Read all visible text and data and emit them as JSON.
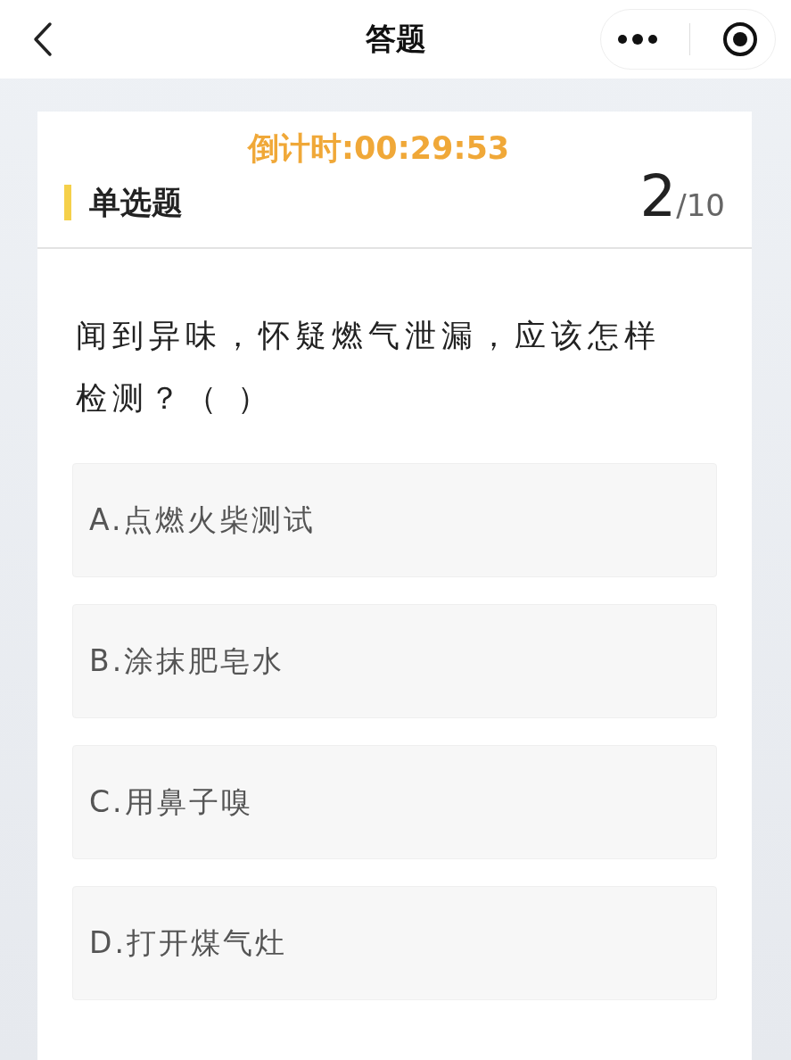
{
  "nav": {
    "title": "答题"
  },
  "header": {
    "countdown": "倒计时:00:29:53",
    "type_label": "单选题",
    "current": "2",
    "total": "/10"
  },
  "question": "闻到异味，怀疑燃气泄漏，应该怎样检测？（ ）",
  "options": [
    {
      "text": "A.点燃火柴测试"
    },
    {
      "text": "B.涂抹肥皂水"
    },
    {
      "text": "C.用鼻子嗅"
    },
    {
      "text": "D.打开煤气灶"
    }
  ]
}
